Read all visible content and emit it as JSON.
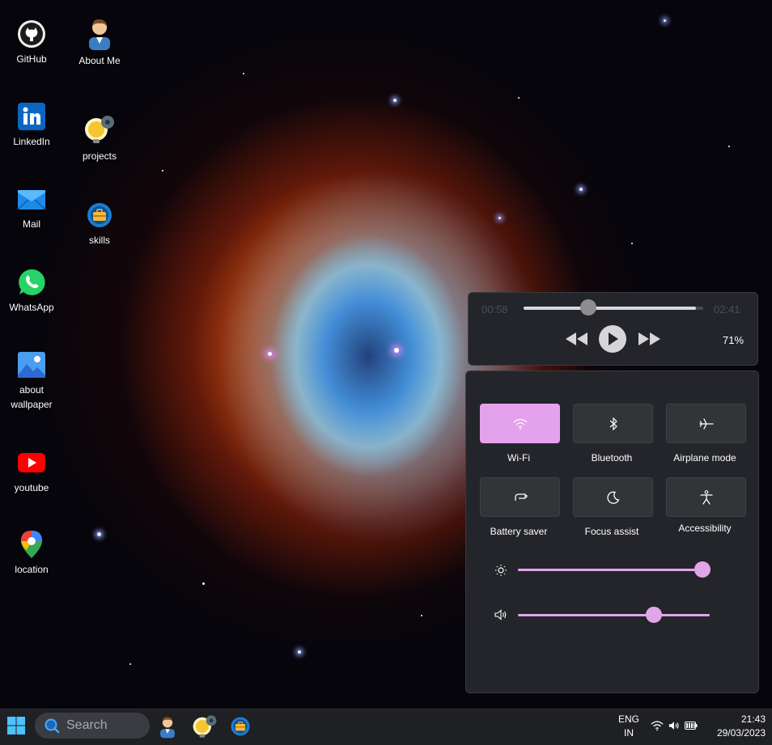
{
  "desktop": {
    "icons": [
      {
        "label": "GitHub",
        "icon": "github-icon"
      },
      {
        "label": "About Me",
        "icon": "person-icon"
      },
      {
        "label": "LinkedIn",
        "icon": "linkedin-icon"
      },
      {
        "label": "projects",
        "icon": "lightbulb-gear-icon"
      },
      {
        "label": "Mail",
        "icon": "mail-icon"
      },
      {
        "label": "skills",
        "icon": "toolbox-icon"
      },
      {
        "label": "WhatsApp",
        "icon": "whatsapp-icon"
      },
      {
        "label": "about wallpaper",
        "icon": "image-icon"
      },
      {
        "label": "youtube",
        "icon": "youtube-icon"
      },
      {
        "label": "location",
        "icon": "map-pin-icon"
      }
    ]
  },
  "media": {
    "elapsed": "00:58",
    "total": "02:41",
    "progress": 0.36,
    "volume_label": "71%"
  },
  "quick_settings": {
    "tiles": [
      {
        "label": "Wi-Fi",
        "icon": "wifi-icon",
        "active": true
      },
      {
        "label": "Bluetooth",
        "icon": "bluetooth-icon",
        "active": false
      },
      {
        "label": "Airplane mode",
        "icon": "airplane-icon",
        "active": false
      },
      {
        "label": "Battery saver",
        "icon": "battery-saver-icon",
        "active": false
      },
      {
        "label": "Focus assist",
        "icon": "moon-icon",
        "active": false
      },
      {
        "label": "Accessibility",
        "icon": "accessibility-icon",
        "active": false
      }
    ],
    "brightness": 1.0,
    "volume": 0.71,
    "accent": "#e0a6e9"
  },
  "taskbar": {
    "search_placeholder": "Search",
    "language_top": "ENG",
    "language_bottom": "IN",
    "time": "21:43",
    "date": "29/03/2023"
  }
}
